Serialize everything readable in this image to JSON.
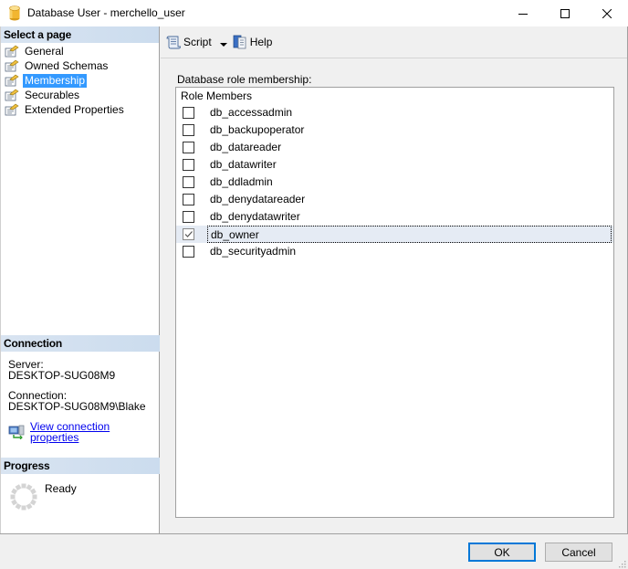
{
  "window": {
    "title": "Database User - merchello_user",
    "icon": "database-icon",
    "controls": {
      "minimize": "minimize-icon",
      "maximize": "maximize-icon",
      "close": "close-icon"
    }
  },
  "left_pane": {
    "select_page_header": "Select a page",
    "pages": [
      {
        "label": "General",
        "icon": "property-page-icon",
        "selected": false
      },
      {
        "label": "Owned Schemas",
        "icon": "property-page-icon",
        "selected": false
      },
      {
        "label": "Membership",
        "icon": "property-page-icon",
        "selected": true
      },
      {
        "label": "Securables",
        "icon": "property-page-icon",
        "selected": false
      },
      {
        "label": "Extended Properties",
        "icon": "property-page-icon",
        "selected": false
      }
    ],
    "connection": {
      "header": "Connection",
      "server_label": "Server:",
      "server_value": "DESKTOP-SUG08M9",
      "connection_label": "Connection:",
      "connection_value": "DESKTOP-SUG08M9\\Blake",
      "link_label": "View connection properties"
    },
    "progress": {
      "header": "Progress",
      "status": "Ready"
    }
  },
  "toolbar": {
    "script_label": "Script",
    "help_label": "Help"
  },
  "main": {
    "section_label": "Database role membership:",
    "list_header": "Role Members",
    "roles": [
      {
        "name": "db_accessadmin",
        "checked": false
      },
      {
        "name": "db_backupoperator",
        "checked": false
      },
      {
        "name": "db_datareader",
        "checked": false
      },
      {
        "name": "db_datawriter",
        "checked": false
      },
      {
        "name": "db_ddladmin",
        "checked": false
      },
      {
        "name": "db_denydatareader",
        "checked": false
      },
      {
        "name": "db_denydatawriter",
        "checked": false
      },
      {
        "name": "db_owner",
        "checked": true
      },
      {
        "name": "db_securityadmin",
        "checked": false
      }
    ]
  },
  "footer": {
    "ok_label": "OK",
    "cancel_label": "Cancel"
  },
  "colors": {
    "selection": "#3399ff",
    "section_header": "#d3e0ef",
    "focused_row": "#e5ebf4",
    "default_button_border": "#0078d7",
    "link": "#0000ee"
  }
}
